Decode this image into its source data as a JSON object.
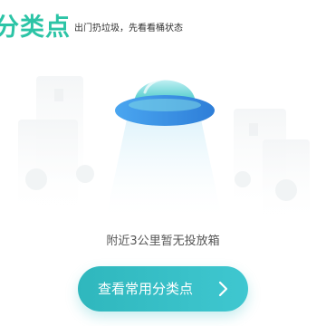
{
  "header": {
    "title": "分类点",
    "subtitle": "出门扔垃圾，先看看桶状态"
  },
  "empty_state": {
    "message": "附近3公里暂无投放箱",
    "illustration_icon": "ufo-empty-icon"
  },
  "cta": {
    "label": "查看常用分类点",
    "icon": "chevron-right-icon"
  },
  "colors": {
    "accent": "#2cc4a6",
    "button": "#3bbfc6",
    "text_muted": "#555555"
  }
}
